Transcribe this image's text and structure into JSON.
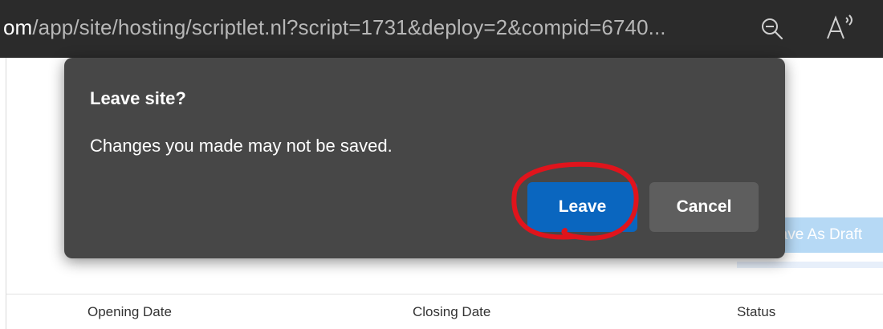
{
  "browser": {
    "url_host": "om",
    "url_path": "/app/site/hosting/scriptlet.nl?script=1731&deploy=2&compid=6740...",
    "zoom_icon": "zoom-out-icon",
    "read_aloud_icon": "read-aloud-icon"
  },
  "dialog": {
    "title": "Leave site?",
    "message": "Changes you made may not be saved.",
    "leave_label": "Leave",
    "cancel_label": "Cancel"
  },
  "page": {
    "save_draft_label": "Save As Draft",
    "table_headers": [
      "Opening Date",
      "Closing Date",
      "Status"
    ]
  },
  "colors": {
    "dialog_bg": "#474747",
    "leave_button": "#0a66bf",
    "cancel_button": "#5e5e5e",
    "annotation": "#e0141c"
  }
}
